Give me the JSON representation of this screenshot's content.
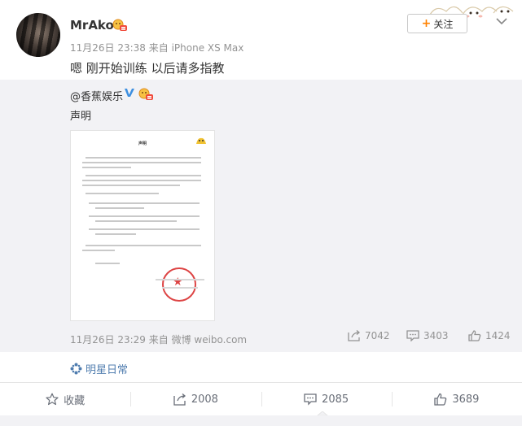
{
  "post": {
    "username": "MrAko",
    "meta": "11月26日 23:38 来自 iPhone XS Max",
    "text": "嗯 刚开始训练 以后请多指教",
    "follow_label": "关注",
    "follow_icon": "plus-icon",
    "accent_color": "#ff8200"
  },
  "repost": {
    "author": "@香蕉娱乐",
    "text": "声明",
    "image": {
      "title": "声明"
    },
    "meta": "11月26日 23:29 来自 微博 weibo.com",
    "stats": {
      "reposts": "7042",
      "comments": "3403",
      "likes": "1424"
    }
  },
  "topic": {
    "label": "明星日常",
    "icon": "topic-icon",
    "color": "#507daf"
  },
  "footer": {
    "favorite_label": "收藏",
    "repost_count": "2008",
    "comment_count": "2085",
    "like_count": "3689"
  }
}
